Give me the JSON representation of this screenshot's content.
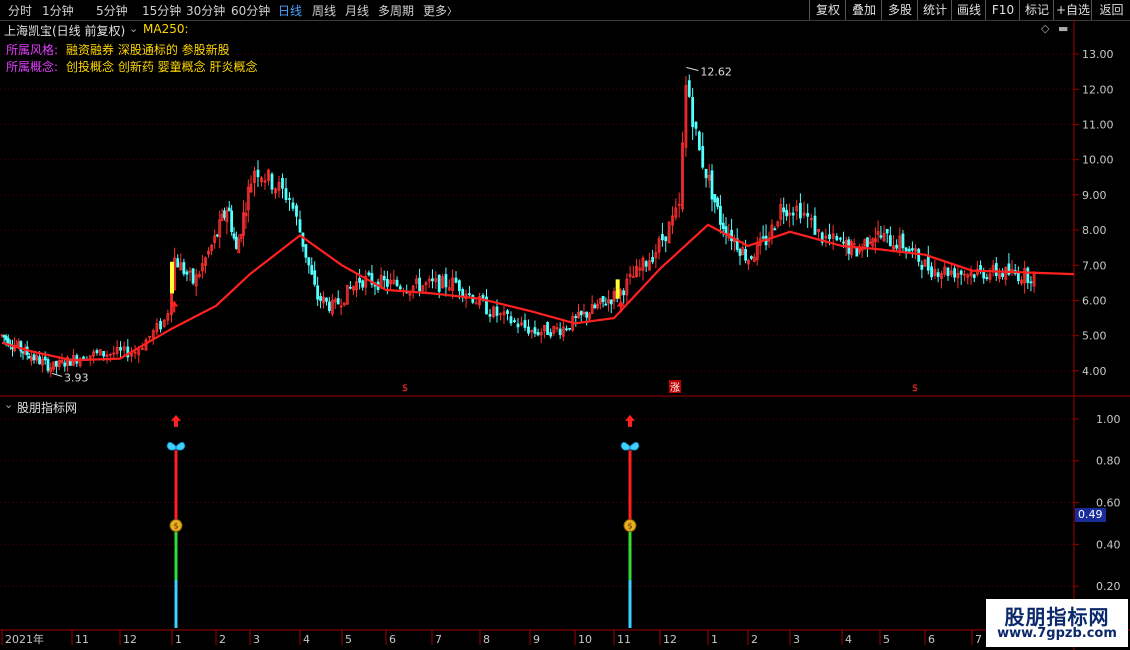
{
  "toolbar": {
    "tabs": [
      {
        "label": "分时",
        "active": false
      },
      {
        "label": "1分钟",
        "active": false
      },
      {
        "label": "5分钟",
        "active": false
      },
      {
        "label": "15分钟",
        "active": false
      },
      {
        "label": "30分钟",
        "active": false
      },
      {
        "label": "60分钟",
        "active": false
      },
      {
        "label": "日线",
        "active": true
      },
      {
        "label": "周线",
        "active": false
      },
      {
        "label": "月线",
        "active": false
      },
      {
        "label": "多周期",
        "active": false
      },
      {
        "label": "更多",
        "active": false
      }
    ],
    "more_arrow": "〉",
    "right_buttons": [
      "复权",
      "叠加",
      "多股",
      "统计",
      "画线",
      "F10",
      "标记",
      "+自选",
      "返回"
    ]
  },
  "header": {
    "title": "上海凯宝(日线 前复权)",
    "ma_label": "MA250:",
    "style_label": "所属风格:",
    "style_value": "融资融券 深股通标的 参股新股",
    "concept_label": "所属概念:",
    "concept_value": "创投概念 创新药 婴童概念 肝炎概念"
  },
  "indicator": {
    "title": "股朋指标网",
    "current_value": "0.49"
  },
  "watermark": {
    "line1": "股朋指标网",
    "line2": "www.7gpzb.com"
  },
  "colors": {
    "bg": "#000000",
    "grid": "#5a0000",
    "up": "#ff3030",
    "down": "#54ffff",
    "ma": "#ff2020",
    "axis_text": "#c8c8c8",
    "active_tab": "#4aa3ff"
  },
  "chart_data": [
    {
      "type": "candlestick",
      "title": "上海凯宝(日线 前复权)",
      "series": [
        {
          "name": "MA250",
          "x": [
            "2021-09",
            "2021-10",
            "2021-11",
            "2021-12",
            "2022-01",
            "2022-02",
            "2022-03",
            "2022-04",
            "2022-05",
            "2022-06",
            "2022-07",
            "2022-08",
            "2022-09",
            "2022-10",
            "2022-11",
            "2022-12",
            "2023-01",
            "2023-02",
            "2023-03",
            "2023-04",
            "2023-05",
            "2023-06",
            "2023-07"
          ],
          "values": [
            4.8,
            4.55,
            4.3,
            4.35,
            5.2,
            5.85,
            6.75,
            7.85,
            7.0,
            6.3,
            6.2,
            6.05,
            5.7,
            5.35,
            5.5,
            6.9,
            8.15,
            7.55,
            7.95,
            7.55,
            7.45,
            7.3,
            6.85
          ]
        }
      ],
      "price_marks": [
        {
          "label": "12.62",
          "value": 12.62
        },
        {
          "label": "3.93",
          "value": 3.93
        }
      ],
      "y_ticks": [
        "13.00",
        "12.00",
        "11.00",
        "10.00",
        "9.00",
        "8.00",
        "7.00",
        "6.00",
        "5.00",
        "4.00"
      ],
      "ylim": [
        3.4,
        13.4
      ],
      "x_ticks": [
        "2021年",
        "11",
        "12",
        "1",
        "2",
        "3",
        "4",
        "5",
        "6",
        "7",
        "8",
        "9",
        "10",
        "11",
        "12",
        "1",
        "2",
        "3",
        "4",
        "5",
        "6",
        "7"
      ],
      "event_markers": [
        "$",
        "涨",
        "$"
      ]
    },
    {
      "type": "bar",
      "title": "股朋指标网",
      "y_ticks": [
        "1.00",
        "0.80",
        "0.60",
        "0.40",
        "0.20"
      ],
      "ylim": [
        0.0,
        1.1
      ],
      "signals": [
        {
          "month": "2022-01",
          "value": 1.0
        },
        {
          "month": "2022-11",
          "value": 1.0
        }
      ],
      "current_value": 0.49
    }
  ]
}
